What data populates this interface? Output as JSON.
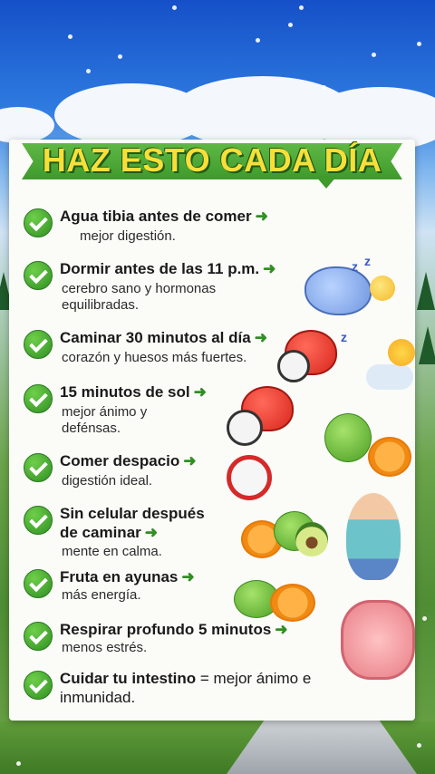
{
  "title": "HAZ ESTO CADA DÍA",
  "arrow_glyph": "➜",
  "items": [
    {
      "head": "Agua tibia antes de comer",
      "sub": "mejor digestión."
    },
    {
      "head": "Dormir antes de las 11 p.m.",
      "sub": "cerebro sano y hormonas equilibradas."
    },
    {
      "head": "Caminar 30 minutos al día",
      "sub": "corazón y huesos más fuertes."
    },
    {
      "head": "15 minutos de sol",
      "sub": "mejor ánimo y defénsas."
    },
    {
      "head": "Comer despacio",
      "sub": "digestión ideal."
    },
    {
      "head": "Sin celular después de caminar",
      "sub": "mente en calma."
    },
    {
      "head": "Fruta en ayunas",
      "sub": "más energía."
    },
    {
      "head": "Respirar profundo 5 minutos",
      "sub": "menos estrés."
    },
    {
      "head": "Cuidar tu intestino",
      "head_tail": "= mejor ánimo e inmunidad."
    }
  ],
  "colors": {
    "accent_green": "#3e9a2b",
    "title_yellow": "#f7df3a",
    "check_green": "#2f8f22"
  }
}
